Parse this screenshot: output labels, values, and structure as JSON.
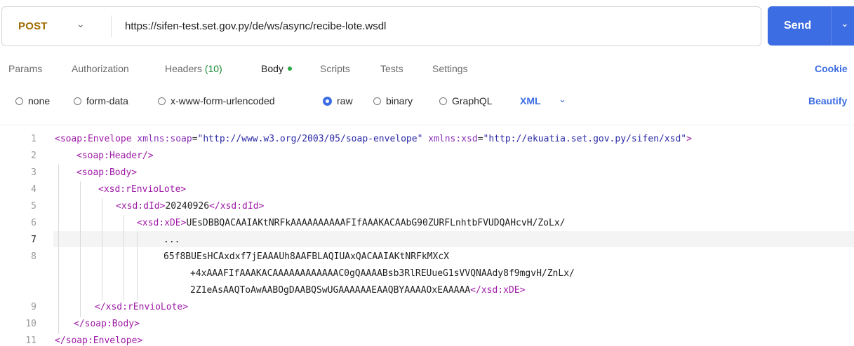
{
  "request": {
    "method": "POST",
    "url": "https://sifen-test.set.gov.py/de/ws/async/recibe-lote.wsdl",
    "send_label": "Send"
  },
  "tabs": {
    "params": "Params",
    "authorization": "Authorization",
    "headers": "Headers",
    "headers_count": "(10)",
    "body": "Body",
    "scripts": "Scripts",
    "tests": "Tests",
    "settings": "Settings",
    "cookies": "Cookie"
  },
  "body_types": {
    "none": "none",
    "form_data": "form-data",
    "urlencoded": "x-www-form-urlencoded",
    "raw": "raw",
    "binary": "binary",
    "graphql": "GraphQL",
    "selected": "raw",
    "format": "XML",
    "beautify": "Beautify"
  },
  "editor": {
    "current_line": 7,
    "line_numbers": [
      "1",
      "2",
      "3",
      "4",
      "5",
      "6",
      "7",
      "8",
      "9",
      "10",
      "11"
    ],
    "lines": {
      "l1": {
        "open": "<soap:Envelope ",
        "a1": "xmlns:soap",
        "eq1": "=",
        "v1": "\"http://www.w3.org/2003/05/soap-envelope\"",
        "a2": " xmlns:xsd",
        "eq2": "=",
        "v2": "\"http://ekuatia.set.gov.py/sifen/xsd\"",
        "close": ">"
      },
      "l2": "<soap:Header/>",
      "l3": "<soap:Body>",
      "l4": "<xsd:rEnvioLote>",
      "l5": {
        "open": "<xsd:dId>",
        "text": "20240926",
        "close": "</xsd:dId>"
      },
      "l6": {
        "open": "<xsd:xDE>",
        "text": "UEsDBBQACAAIAKtNRFkAAAAAAAAAAFIfAAAKACAAbG90ZURFLnhtbFVUDQAHcvH/ZoLx/"
      },
      "l7": "...",
      "l8a": "65f8BUEsHCAxdxf7jEAAAUh8AAFBLAQIUAxQACAAIAKtNRFkMXcX",
      "l8b": "+4xAAAFIfAAAKACAAAAAAAAAAAAC0gQAAAABsb3RlREUueG1sVVQNAAdy8f9mgvH/ZnLx/",
      "l8c": {
        "text": "2Z1eAsAAQToAwAABOgDAABQSwUGAAAAAAEAAQBYAAAAOxEAAAAA",
        "close": "</xsd:xDE>"
      },
      "l9": "</xsd:rEnvioLote>",
      "l10": "</soap:Body>",
      "l11": "</soap:Envelope>"
    }
  },
  "colors": {
    "method": "#a06a00",
    "accent": "#3d6de3",
    "tag": "#9e1aa6",
    "attr_value": "#2a2aa6"
  }
}
